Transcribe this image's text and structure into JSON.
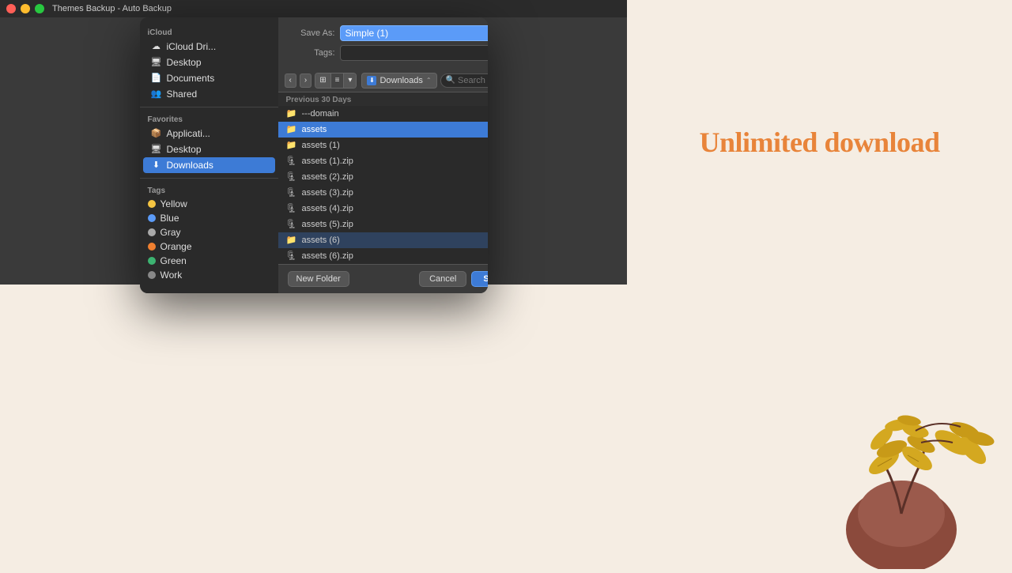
{
  "app": {
    "title": "Themes Backup - Auto Backup"
  },
  "dialog": {
    "save_as_label": "Save As:",
    "save_as_value": "Simple (1)",
    "tags_label": "Tags:",
    "tags_value": "",
    "location": "Downloads",
    "search_placeholder": "Search"
  },
  "sidebar": {
    "icloud_section": "iCloud",
    "icloud_items": [
      {
        "label": "iCloud Dri...",
        "icon": "☁"
      },
      {
        "label": "Desktop",
        "icon": "🖥"
      },
      {
        "label": "Documents",
        "icon": "📄"
      },
      {
        "label": "Shared",
        "icon": "👥"
      }
    ],
    "favorites_section": "Favorites",
    "favorites_items": [
      {
        "label": "Applicati...",
        "icon": "📦"
      },
      {
        "label": "Desktop",
        "icon": "🖥"
      },
      {
        "label": "Downloads",
        "icon": "⬇",
        "active": true
      }
    ],
    "tags_section": "Tags",
    "tags": [
      {
        "label": "Yellow",
        "color": "#f5c542"
      },
      {
        "label": "Blue",
        "color": "#5b9bf8"
      },
      {
        "label": "Gray",
        "color": "#aaa"
      },
      {
        "label": "Orange",
        "color": "#f08030"
      },
      {
        "label": "Green",
        "color": "#3cb371"
      },
      {
        "label": "Work",
        "color": "#888"
      }
    ]
  },
  "toolbar": {
    "back_label": "‹",
    "forward_label": "›",
    "view_icon_label": "⊞",
    "view_list_label": "≡",
    "view_arrow_label": "▾",
    "expand_label": "⌃"
  },
  "file_section": {
    "header": "Previous 30 Days"
  },
  "files": [
    {
      "name": "---domain",
      "type": "folder",
      "has_arrow": false
    },
    {
      "name": "assets",
      "type": "folder",
      "selected": true,
      "has_arrow": true
    },
    {
      "name": "assets (1)",
      "type": "folder",
      "has_arrow": true
    },
    {
      "name": "assets (1).zip",
      "type": "zip"
    },
    {
      "name": "assets (2).zip",
      "type": "zip"
    },
    {
      "name": "assets (3).zip",
      "type": "zip"
    },
    {
      "name": "assets (4).zip",
      "type": "zip"
    },
    {
      "name": "assets (5).zip",
      "type": "zip"
    },
    {
      "name": "assets (6)",
      "type": "folder",
      "selected_folder": true,
      "has_arrow": true
    },
    {
      "name": "assets (6).zip",
      "type": "zip"
    }
  ],
  "footer": {
    "new_folder_label": "New Folder",
    "cancel_label": "Cancel",
    "save_label": "Save"
  },
  "right_content": {
    "unlimited_text": "Unlimited download"
  },
  "colors": {
    "accent_orange": "#e8843a",
    "bg_cream": "#f5ede3",
    "plant_brown": "#8b4a3c",
    "plant_yellow": "#d4a017"
  }
}
